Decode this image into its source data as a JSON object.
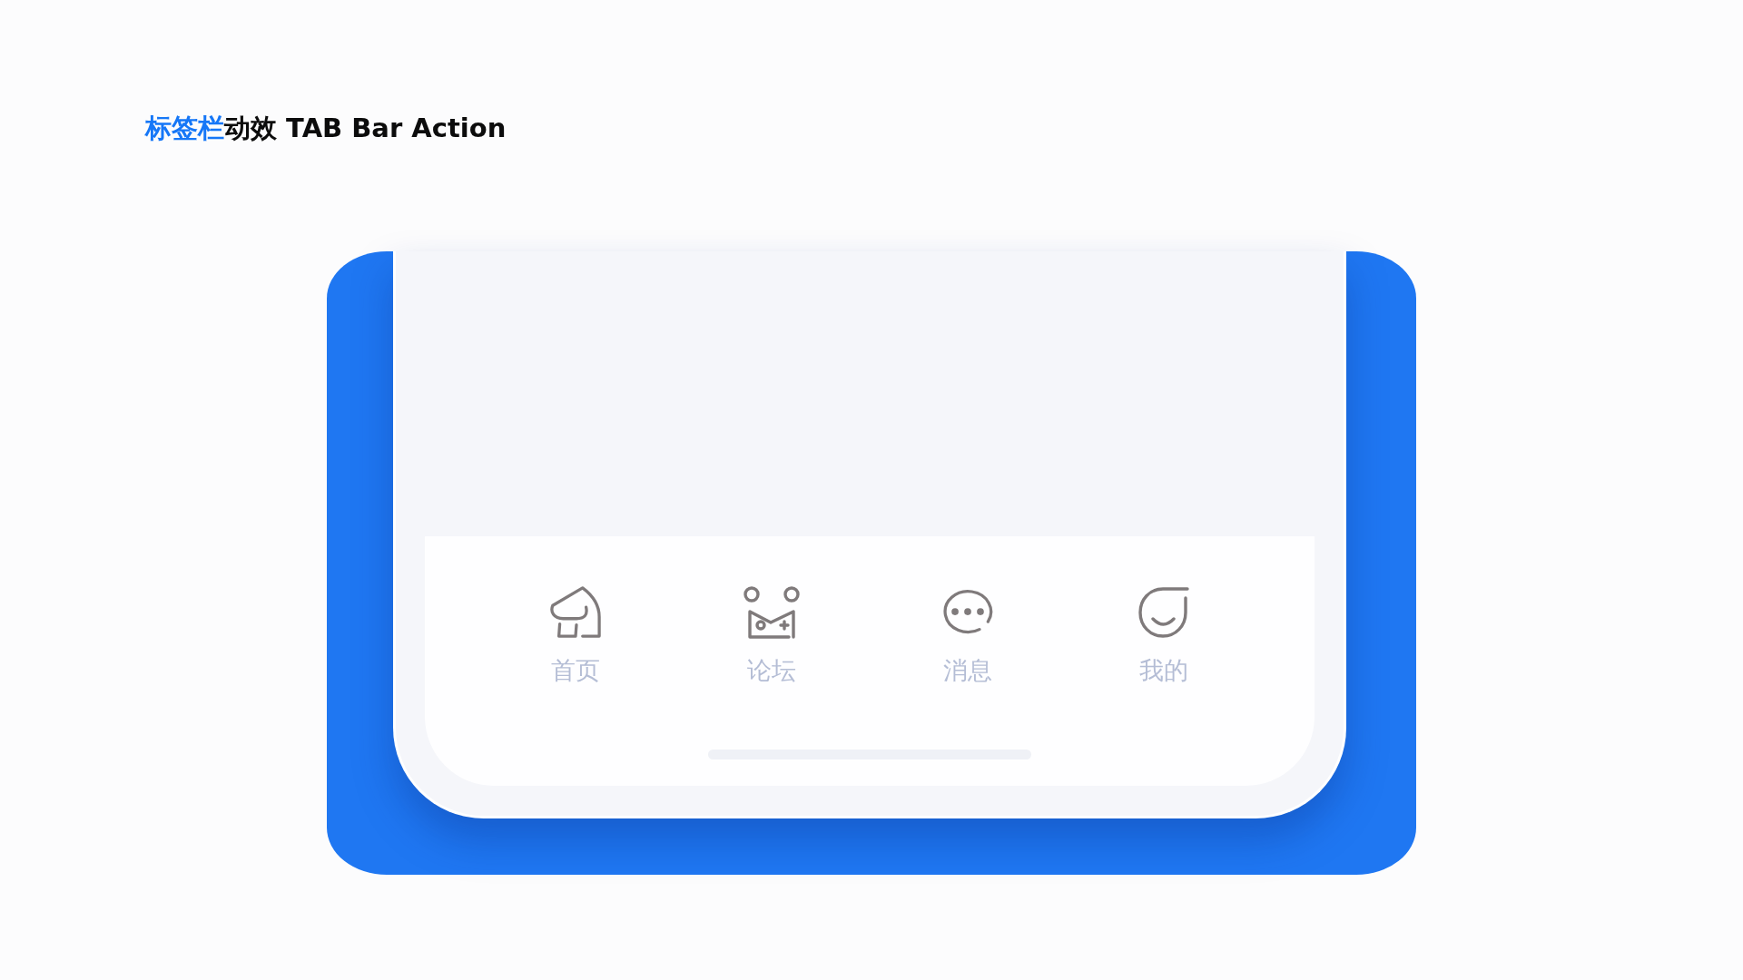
{
  "title": {
    "highlight": "标签栏",
    "text": "动效 TAB Bar Action"
  },
  "tabs": [
    {
      "label": "首页",
      "selected": false
    },
    {
      "label": "论坛",
      "selected": false
    },
    {
      "label": "消息",
      "selected": false
    },
    {
      "label": "我的",
      "selected": false
    }
  ]
}
